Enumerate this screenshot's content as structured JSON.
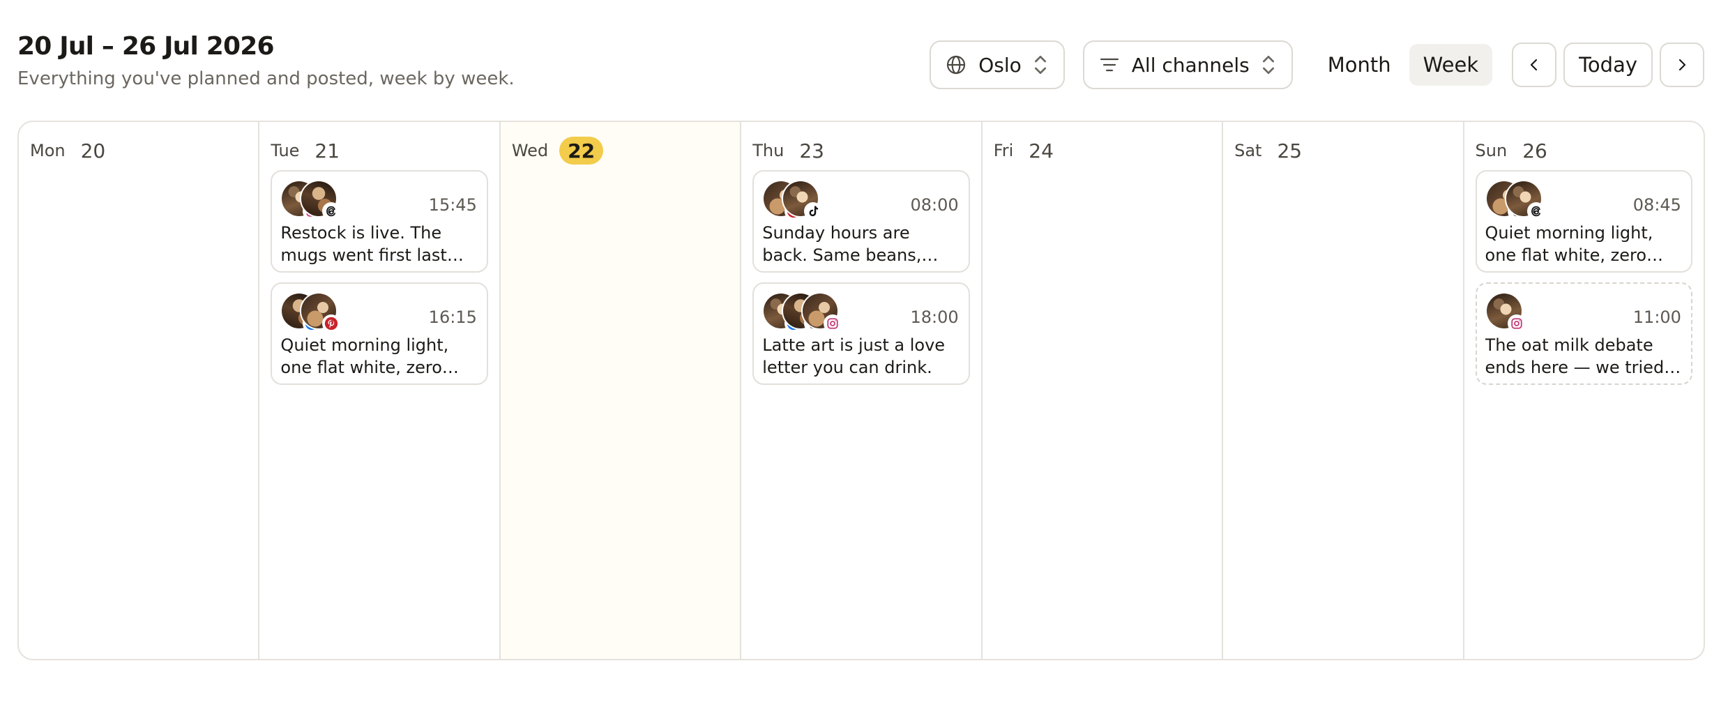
{
  "header": {
    "title": "20 Jul – 26 Jul 2026",
    "subtitle": "Everything you've planned and posted, week by week."
  },
  "controls": {
    "city": "Oslo",
    "channels": "All channels",
    "views": [
      "Month",
      "Week"
    ],
    "active_view": "Week",
    "today_label": "Today"
  },
  "colors": {
    "today_badge": "#f2cc4a",
    "instagram": "#c23b78",
    "pinterest": "#c8232c",
    "facebook": "#1877f2",
    "tiktok": "#111111",
    "threads": "#111111"
  },
  "days": [
    {
      "dow": "Mon",
      "num": "20",
      "posts": []
    },
    {
      "dow": "Tue",
      "num": "21",
      "posts": [
        {
          "time": "15:45",
          "text": "Restock is live. The mugs went first last time, so don't wait.",
          "avatars": [
            {
              "channel": "instagram-icon"
            },
            {
              "channel": "threads-icon"
            }
          ]
        },
        {
          "time": "16:15",
          "text": "Quiet morning light, one flat white, zero notifications.",
          "avatars": [
            {
              "channel": "facebook-icon"
            },
            {
              "channel": "pinterest-icon"
            }
          ]
        }
      ]
    },
    {
      "dow": "Wed",
      "num": "22",
      "today": true,
      "posts": []
    },
    {
      "dow": "Thu",
      "num": "23",
      "posts": [
        {
          "time": "08:00",
          "text": "Sunday hours are back. Same beans, slower pace.",
          "avatars": [
            {
              "channel": "pinterest-icon"
            },
            {
              "channel": "tiktok-icon"
            }
          ]
        },
        {
          "time": "18:00",
          "text": "Latte art is just a love letter you can drink.",
          "avatars": [
            {
              "channel": "facebook-icon"
            },
            {
              "channel": "tiktok-icon"
            },
            {
              "channel": "instagram-icon"
            }
          ]
        }
      ]
    },
    {
      "dow": "Fri",
      "num": "24",
      "posts": []
    },
    {
      "dow": "Sat",
      "num": "25",
      "posts": []
    },
    {
      "dow": "Sun",
      "num": "26",
      "posts": [
        {
          "time": "08:45",
          "text": "Quiet morning light, one flat white, zero notifications.",
          "avatars": [
            {
              "channel": "tiktok-icon"
            },
            {
              "channel": "threads-icon"
            }
          ]
        },
        {
          "time": "11:00",
          "text": "The oat milk debate ends here — we tried eleven, so you don't have to.",
          "draft": true,
          "avatars": [
            {
              "channel": "instagram-icon"
            }
          ]
        }
      ]
    }
  ]
}
